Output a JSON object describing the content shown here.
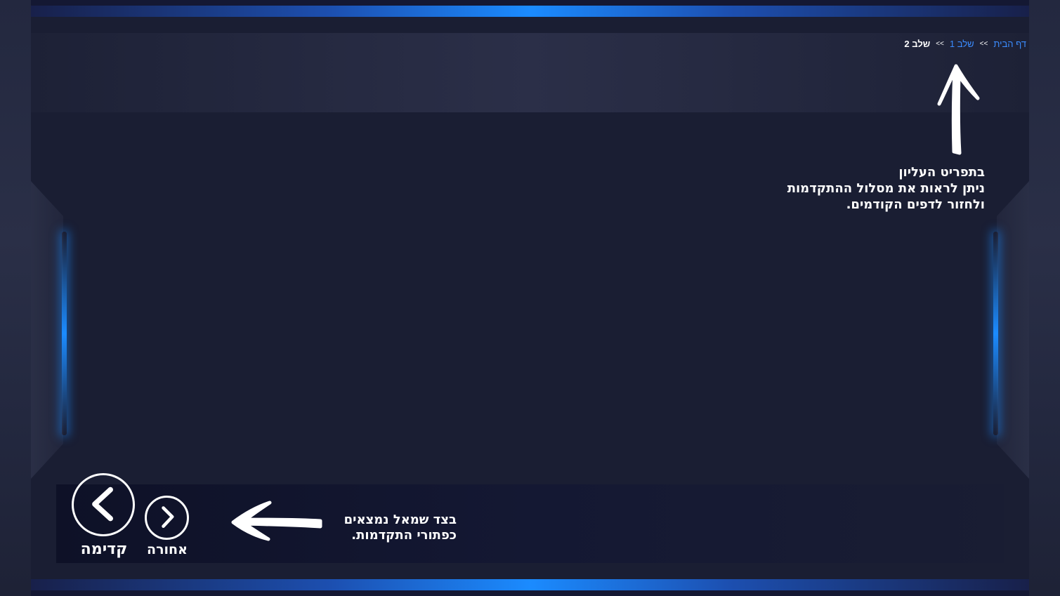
{
  "breadcrumb": {
    "home": "דף הבית",
    "separator": ">>",
    "step1": "שלב 1",
    "current": "שלב 2"
  },
  "notes": {
    "top_line1": "בתפריט העליון",
    "top_line2": "ניתן לראות את מסלול ההתקדמות",
    "top_line3": "ולחזור לדפים הקודמים.",
    "bottom_line1": "בצד שמאל נמצאים",
    "bottom_line2": "כפתורי התקדמות."
  },
  "nav": {
    "next_label": "קדימה",
    "back_label": "אחורה",
    "next_icon": "chevron-left-icon",
    "back_icon": "chevron-right-icon"
  },
  "colors": {
    "background": "#1a1e33",
    "accent_blue": "#1b8bff",
    "link_blue": "#3b8cff",
    "text": "#ffffff"
  }
}
